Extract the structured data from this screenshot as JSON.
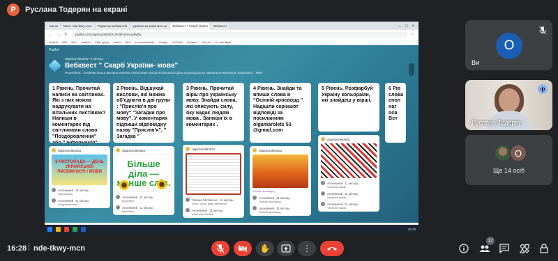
{
  "presenter": {
    "initial": "Р",
    "title": "Руслана Тодерян на екрані",
    "avatar_color": "#e8603c"
  },
  "browser": {
    "tabs": [
      "Меню",
      "Meet: nde-tkwy-mcn",
      "Редактор вебквестів",
      "українська мова мен-кн",
      "Вебквест \" Скарб Україн",
      "Вебквест"
    ],
    "url": "padlet.com/olgamarolets531/9cl9h4n4oupfbgfw",
    "bookmarks": [
      "Знайти",
      "Wifi",
      "Vibe",
      "Новини",
      "Сайт курсу",
      "Canva",
      "Вісті",
      "Liveworksheets",
      "Google",
      "YouTube",
      "Корисне",
      "Ukr.net",
      "Усі закладки"
    ]
  },
  "padlet": {
    "brand": "Padlet",
    "author": "olgamarolets531 • 1 місяць",
    "title": "Вебквест \" Скарб України- мова\"",
    "subtitle": "Розробила : Олейник Ольга Іванівна вчитель початкових класів Котовського фіту Бульводського навчально-виховного комплексу \" НВК\"",
    "columns": [
      {
        "heading": "1 Рівень. Прочитай написи на світлинах. Які з них можна надрукувати на вітальних листівках? Напиши в коментарях під світлинами слово \"Поздоровлення\" або \" Інформація\"",
        "post_author": "olgamarolets531",
        "image_text": "9 ЛИСТОПАДА — ДЕНЬ УКРАЇНСЬКОЇ ПИСЕМНОСТІ І МОВИ",
        "comments": [
          {
            "author": "Анонімний",
            "time": "11 місяць",
            "text": "інформація"
          },
          {
            "author": "Анонімний",
            "time": "11 місяць",
            "text": "поздоровлення"
          }
        ]
      },
      {
        "heading": "2 Рівень. Відшукай вислови, які можна об'єднати в дві групи : \"Прислів'я про мову\" \"Загадки про мову\". У коментарях підпиши відповідну назву \"Прислів'я\", \" Загадка \"",
        "post_author": "olgamarolets531",
        "image_text": "Більше діла — менше слів.",
        "comments": [
          {
            "author": "Анонімний",
            "time": "11 місяць",
            "text": "прислів'я"
          },
          {
            "author": "Анонімний",
            "time": "11 місяць",
            "text": "прислів'я"
          }
        ]
      },
      {
        "heading": "3 Рівень. Прочитай вірш про українську мову. Знайди слова, які описують силу, яку надає людям мова . Запиши їх в коментарях .",
        "post_author": "olgamarolets531",
        "image_text": "",
        "comments": [
          {
            "author": "Галина Матвієнко",
            "time": "11 місяць",
            "text": "Успіх, сила, віра, світлячок"
          },
          {
            "author": "Анонімний",
            "time": "11 місяць",
            "text": "мова українська"
          }
        ]
      },
      {
        "heading": "4 Рівень. Знайди та впиши слова в \"Осінній кросворд \" Надішли скріншот відповіді за посиланням olgamarolets 53 @gmail.com",
        "post_author": "olgamarolets531",
        "image_text": "",
        "caption": "Осінній кросворд",
        "comments": [
          {
            "author": "Анонімний",
            "time": "11 місяць",
            "text": "Осінній кросворд"
          },
          {
            "author": "Анонімний",
            "time": "11 місяць",
            "text": "Осінній кросворд"
          }
        ]
      },
      {
        "heading": "5 Рівень. Розфарбуй Україну кольорами, які знайдеш у вірші.",
        "post_author": "olgamarolets531",
        "image_text": "",
        "comments": [
          {
            "author": "Анонімний",
            "time": "11 місяць",
            "text": "Червоне маків"
          },
          {
            "author": "Анонімний",
            "time": "11 місяць",
            "text": "Червоне маків"
          },
          {
            "author": "Анонімний",
            "time": "11 місяць",
            "text": "Червоне маків"
          }
        ]
      },
      {
        "heading": "6 Рів слова спол наг осв Вст"
      }
    ]
  },
  "taskbar": {
    "clock": "16:28"
  },
  "participants": {
    "self": {
      "initial": "О",
      "name": "Ви",
      "color": "#1a5fb4"
    },
    "presenter_tile": {
      "name": "Руслана Тодерян"
    },
    "others": {
      "initial": "О",
      "label": "Ще 14 осіб"
    }
  },
  "bottom": {
    "time": "16:28",
    "separator": "|",
    "meeting_code": "nde-tkwy-mcn",
    "people_count": "17"
  },
  "colors": {
    "background": "#202124",
    "tile": "#3c4043",
    "danger": "#ea4335",
    "accent": "#8ab4f8"
  },
  "icons": [
    "mic-off-icon",
    "camera-off-icon",
    "raise-hand-icon",
    "present-icon",
    "more-icon",
    "hang-up-icon",
    "info-icon",
    "people-icon",
    "chat-icon",
    "activities-icon",
    "lock-icon"
  ]
}
